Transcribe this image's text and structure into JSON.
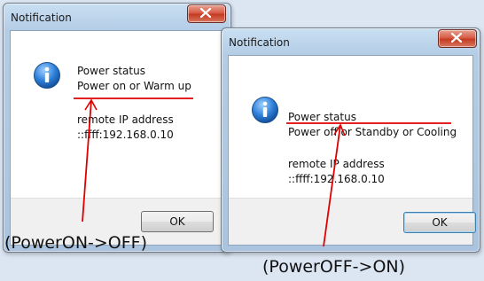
{
  "dialog_left": {
    "title": "Notification",
    "message_heading": "Power status",
    "message_status": "Power on or Warm up",
    "ip_label": "remote IP address",
    "ip_value": "::ffff:192.168.0.10",
    "ok_label": "OK",
    "icon": "info-icon",
    "close_icon": "close-icon"
  },
  "dialog_right": {
    "title": "Notification",
    "message_heading": "Power status",
    "message_status": "Power off or Standby or Cooling",
    "ip_label": "remote IP address",
    "ip_value": "::ffff:192.168.0.10",
    "ok_label": "OK",
    "icon": "info-icon",
    "close_icon": "close-icon"
  },
  "captions": {
    "left": "(PowerON->OFF)",
    "right": "(PowerOFF->ON)"
  },
  "colors": {
    "annotation": "#e00000",
    "background": "#dce6f2",
    "close_button": "#c94a34"
  }
}
